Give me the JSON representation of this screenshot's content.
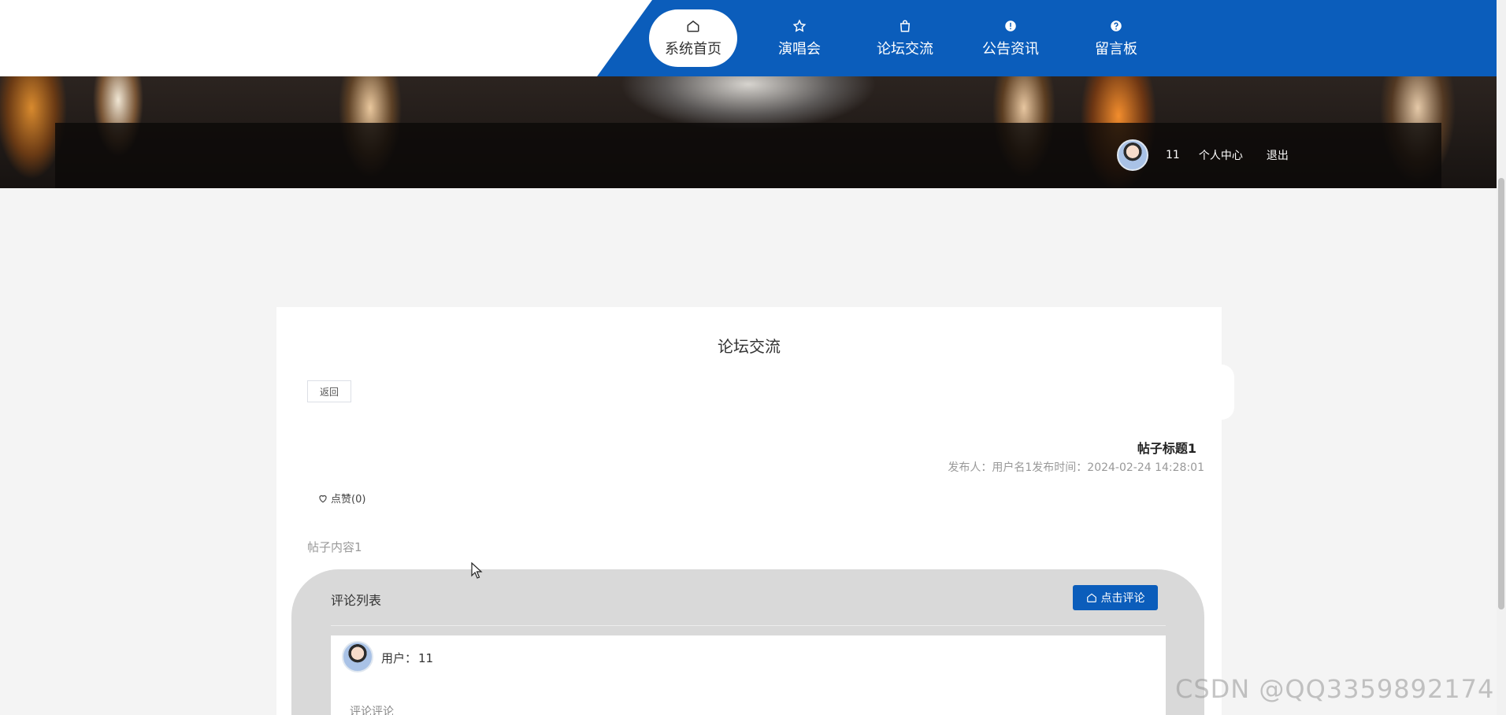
{
  "nav": {
    "items": [
      {
        "label": "系统首页",
        "icon": "home-icon",
        "active": true
      },
      {
        "label": "演唱会",
        "icon": "star-icon",
        "active": false
      },
      {
        "label": "论坛交流",
        "icon": "bag-icon",
        "active": false
      },
      {
        "label": "公告资讯",
        "icon": "alert-circle-icon",
        "active": false
      },
      {
        "label": "留言板",
        "icon": "help-circle-icon",
        "active": false
      }
    ]
  },
  "user": {
    "name": "11",
    "center_label": "个人中心",
    "logout_label": "退出"
  },
  "page": {
    "title": "论坛交流",
    "back_label": "返回"
  },
  "post": {
    "title": "帖子标题1",
    "meta": "发布人：用户名1发布时间：2024-02-24 14:28:01",
    "like_label": "点赞(0)",
    "content": "帖子内容1"
  },
  "comments": {
    "title": "评论列表",
    "button_label": "点击评论",
    "items": [
      {
        "user_label": "用户：",
        "user": "11",
        "text": "评论评论"
      }
    ]
  },
  "watermark": "CSDN @QQ3359892174",
  "colors": {
    "primary": "#0b5dbb",
    "page_bg": "#f4f4f4",
    "comments_bg": "#d9d9d9"
  }
}
